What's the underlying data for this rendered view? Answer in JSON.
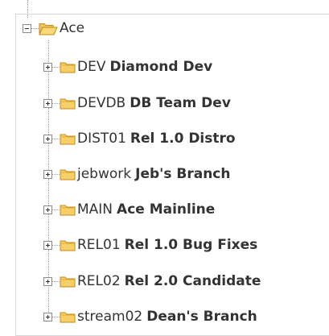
{
  "tree": {
    "root": {
      "label": "Ace"
    },
    "items": [
      {
        "name": "DEV",
        "desc": "Diamond Dev"
      },
      {
        "name": "DEVDB",
        "desc": "DB Team Dev"
      },
      {
        "name": "DIST01",
        "desc": "Rel 1.0 Distro"
      },
      {
        "name": "jebwork",
        "desc": "Jeb's Branch"
      },
      {
        "name": "MAIN",
        "desc": "Ace Mainline"
      },
      {
        "name": "REL01",
        "desc": "Rel 1.0 Bug Fixes"
      },
      {
        "name": "REL02",
        "desc": "Rel 2.0 Candidate"
      },
      {
        "name": "stream02",
        "desc": "Dean's Branch"
      }
    ]
  },
  "colors": {
    "folder_fill": "#f7cf67",
    "folder_stroke": "#c48a1a",
    "text": "#333333"
  }
}
